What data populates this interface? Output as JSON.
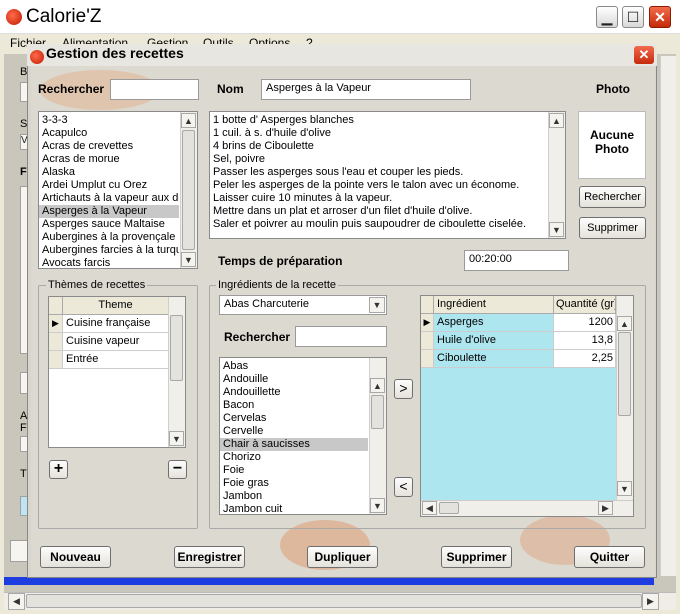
{
  "app": {
    "title": "Calorie'Z",
    "min_glyph": "▁",
    "max_glyph": "☐",
    "close_glyph": "✕"
  },
  "menu": [
    "Fichier",
    "Alimentation",
    "Gestion",
    "Outils",
    "Options",
    "?"
  ],
  "background_stubs": [
    "B",
    "S",
    "V",
    "F",
    "A",
    "F",
    "T"
  ],
  "dialog": {
    "title": "Gestion des recettes",
    "search_label": "Rechercher",
    "search_value": "",
    "name_label": "Nom",
    "name_value": "Asperges à la Vapeur",
    "photo_label": "Photo",
    "photo_placeholder": "Aucune Photo",
    "photo_search_button": "Rechercher",
    "photo_delete_button": "Supprimer",
    "recipes": [
      "3-3-3",
      "Acapulco",
      "Acras de crevettes",
      "Acras de morue",
      "Alaska",
      "Ardei Umplut cu Orez",
      "Artichauts à la vapeur aux de",
      "Asperges à la Vapeur",
      "Asperges sauce Maltaise",
      "Aubergines à la provençale",
      "Aubergines farcies à la turque",
      "Avocats farcis"
    ],
    "selected_recipe_index": 7,
    "instructions": [
      "1 botte d' Asperges blanches",
      "1 cuil. à s. d'huile d'olive",
      "4 brins de Ciboulette",
      "Sel, poivre",
      "Passer les asperges sous l'eau et couper les pieds.",
      "Peler les asperges de la pointe vers le talon avec un économe.",
      "Laisser cuire 10 minutes à la vapeur.",
      "Mettre dans un plat et arroser d'un filet d'huile d'olive.",
      "Saler et poivrer au moulin puis saupoudrer de ciboulette ciselée."
    ],
    "prep_time_label": "Temps de préparation",
    "prep_time_value": "00:20:00",
    "themes_group_label": "Thèmes de recettes",
    "themes_column": "Theme",
    "themes": [
      "Cuisine française",
      "Cuisine vapeur",
      "Entrée"
    ],
    "add_glyph": "+",
    "remove_glyph": "−",
    "ingredients_group_label": "Ingrédients de la recette",
    "category_value": "Abas Charcuterie",
    "ingredient_search_label": "Rechercher",
    "ingredient_search_value": "",
    "ingredient_list": [
      "Abas",
      "Andouille",
      "Andouillette",
      "Bacon",
      "Cervelas",
      "Cervelle",
      "Chair à saucisses",
      "Chorizo",
      "Foie",
      "Foie gras",
      "Jambon",
      "Jambon cuit"
    ],
    "selected_ingredient_index": 6,
    "move_right_glyph": ">",
    "move_left_glyph": "<",
    "ing_columns": [
      "Ingrédient",
      "Quantité (gr)"
    ],
    "recipe_ingredients": [
      {
        "name": "Asperges",
        "qty": "1200"
      },
      {
        "name": "Huile d'olive",
        "qty": "13,8"
      },
      {
        "name": "Ciboulette",
        "qty": "2,25"
      }
    ],
    "buttons": {
      "new": "Nouveau",
      "save": "Enregistrer",
      "duplicate": "Dupliquer",
      "delete": "Supprimer",
      "quit": "Quitter"
    }
  },
  "colors": {
    "accent_blue": "#1e3de0",
    "grid_fill": "#aee6f0",
    "close_red": "#d8391a"
  }
}
